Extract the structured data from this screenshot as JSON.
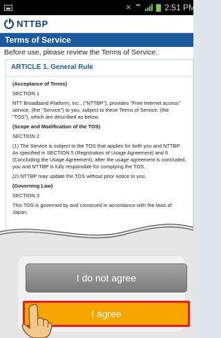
{
  "status_bar": {
    "time": "2:51 PM",
    "icons": [
      "image-icon",
      "mute-icon",
      "wifi-icon",
      "signal-icon",
      "battery-icon"
    ]
  },
  "app": {
    "logo_text": "NTTBP",
    "brand_color": "#0a3f8a"
  },
  "page": {
    "title": "Terms of Service",
    "intro": "Before use, please review the Terms of Service.",
    "header_color": "#1c5aa0"
  },
  "tos": {
    "article_title": "ARTICLE 1. General Rule",
    "sections": [
      {
        "heading": "(Acceptance of Terms)",
        "section": "SECTION 1",
        "paragraphs": [
          "NTT Broadband Platform, Inc., (\"NTTBP\"), provides \"Free Internet access\" service, (the \"Service\") to you, subject to these Terms of Service, (the \"TOS\"), which are described as below."
        ]
      },
      {
        "heading": "(Scope and Modification of the TOS)",
        "section": "SECTION 2",
        "paragraphs": [
          "(1) The Service is subject to the TOS that applies for both you and NTTBP.  As specified in SECTION 5 (Registration of Usage Agreement) and 6 (Concluding the Usage Agreement), after the usage agreement is concluded, you and NTTBP is fully responsible for complying the TOS.",
          "(2) NTTBP may update the TOS without prior notice to you."
        ]
      },
      {
        "heading": "(Governing Law)",
        "section": "SECTION 3",
        "paragraphs": [
          "This TOS is governed by and construed in accordance with the laws of Japan."
        ]
      }
    ]
  },
  "buttons": {
    "disagree_label": "I do not agree",
    "agree_label": "I agree",
    "agree_color": "#f7a500",
    "highlight_color": "#ee1b22"
  }
}
